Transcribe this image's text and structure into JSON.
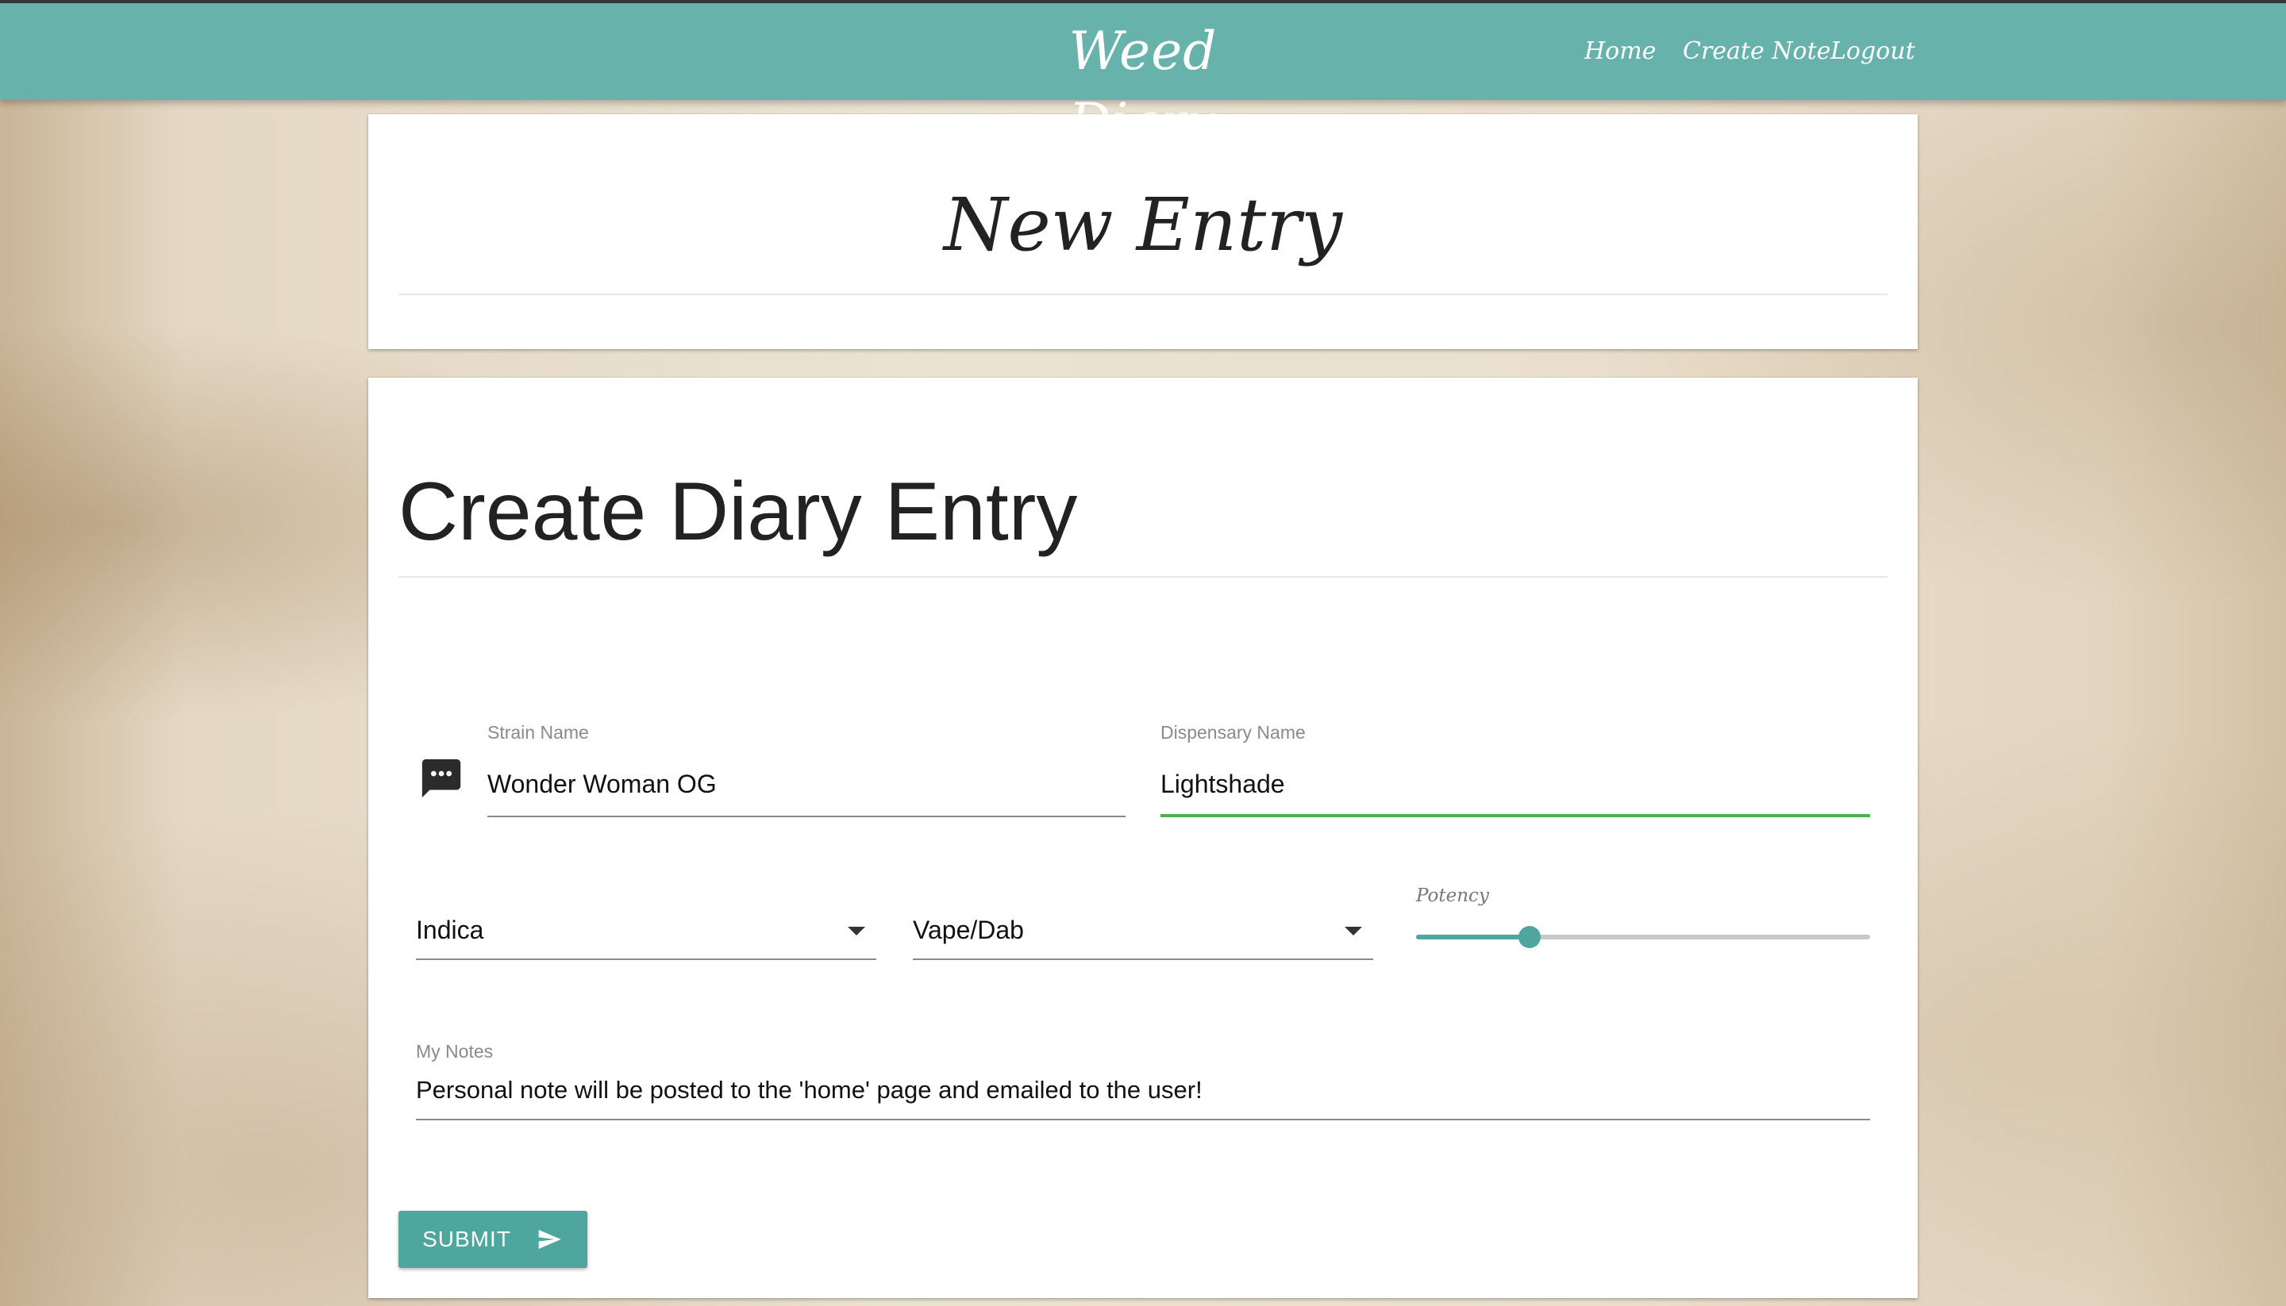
{
  "navbar": {
    "brand": "Weed Diary",
    "links": [
      {
        "label": "Home"
      },
      {
        "label": "Create Note"
      },
      {
        "label": "Logout"
      }
    ],
    "color": "#67b3ab"
  },
  "title_card": {
    "heading": "New Entry"
  },
  "form": {
    "heading": "Create Diary Entry",
    "strain": {
      "label": "Strain Name",
      "value": "Wonder Woman OG",
      "icon": "chat-bubble-icon"
    },
    "dispensary": {
      "label": "Dispensary Name",
      "value": "Lightshade",
      "active_color": "#4caf50"
    },
    "type_select": {
      "value": "Indica"
    },
    "method_select": {
      "value": "Vape/Dab"
    },
    "potency": {
      "label": "Potency",
      "level_fraction": 0.25
    },
    "notes": {
      "label": "My Notes",
      "value": "Personal note will be posted to the 'home' page and emailed to the user!"
    },
    "submit": {
      "label": "SUBMIT",
      "icon": "send-icon",
      "color": "#4ea69f"
    }
  }
}
